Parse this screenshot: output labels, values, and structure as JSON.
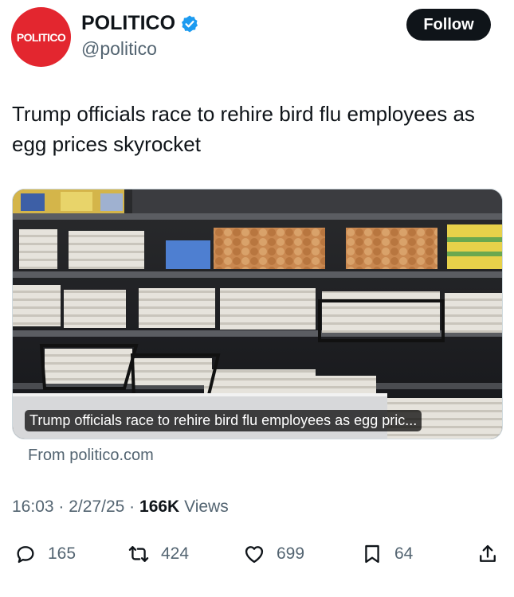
{
  "account": {
    "avatar_text": "POLITICO",
    "display_name": "POLITICO",
    "handle": "@politico",
    "verified_icon": "verified-badge-icon"
  },
  "follow_label": "Follow",
  "tweet": {
    "text": "Trump officials race to rehire bird flu employees as egg prices skyrocket"
  },
  "card": {
    "caption": "Trump officials race to rehire bird flu employees as egg pric...",
    "source": "From politico.com"
  },
  "meta": {
    "time": "16:03",
    "date": "2/27/25",
    "separator": "·",
    "views_count": "166K",
    "views_label": "Views"
  },
  "actions": {
    "replies": "165",
    "reposts": "424",
    "likes": "699",
    "bookmarks": "64"
  },
  "colors": {
    "brand_red": "#e3262f",
    "verified_blue": "#1d9bf0",
    "text_primary": "#0f1419",
    "text_secondary": "#536471"
  }
}
